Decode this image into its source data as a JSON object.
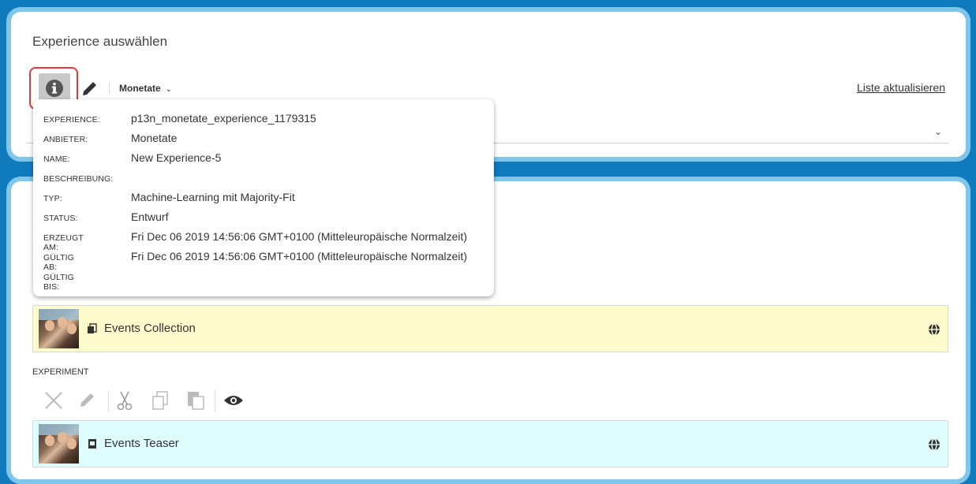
{
  "header": {
    "title": "Experience auswählen",
    "provider_label": "Monetate",
    "refresh_label": "Liste aktualisieren"
  },
  "info_popup": {
    "rows": [
      {
        "key": "EXPERIENCE:",
        "value": "p13n_monetate_experience_1179315"
      },
      {
        "key": "ANBIETER:",
        "value": "Monetate"
      },
      {
        "key": "NAME:",
        "value": "New Experience-5"
      },
      {
        "key": "BESCHREIBUNG:",
        "value": ""
      },
      {
        "key": "TYP:",
        "value": "Machine-Learning mit Majority-Fit"
      },
      {
        "key": "STATUS:",
        "value": "Entwurf"
      },
      {
        "key": "ERZEUGT AM:",
        "value": "Fri Dec 06 2019 14:56:06 GMT+0100 (Mitteleuropäische Normalzeit)"
      },
      {
        "key": "GÜLTIG AB:",
        "value": "Fri Dec 06 2019 14:56:06 GMT+0100 (Mitteleuropäische Normalzeit)"
      },
      {
        "key": "GÜLTIG BIS:",
        "value": ""
      }
    ]
  },
  "content": {
    "collection_label": "Events Collection",
    "experiment_label": "EXPERIMENT",
    "teaser_label": "Events Teaser"
  },
  "colors": {
    "background": "#0f7bbd",
    "panel_border": "#7fc6ea",
    "collection_bg": "#fefccc",
    "teaser_bg": "#dffefe",
    "highlight": "#e03a3a"
  },
  "icons": [
    "info-icon",
    "pencil-icon",
    "chevron-down-icon",
    "collection-icon",
    "teaser-icon",
    "globe-icon",
    "close-icon",
    "cut-icon",
    "copy-icon",
    "paste-icon",
    "eye-icon"
  ]
}
